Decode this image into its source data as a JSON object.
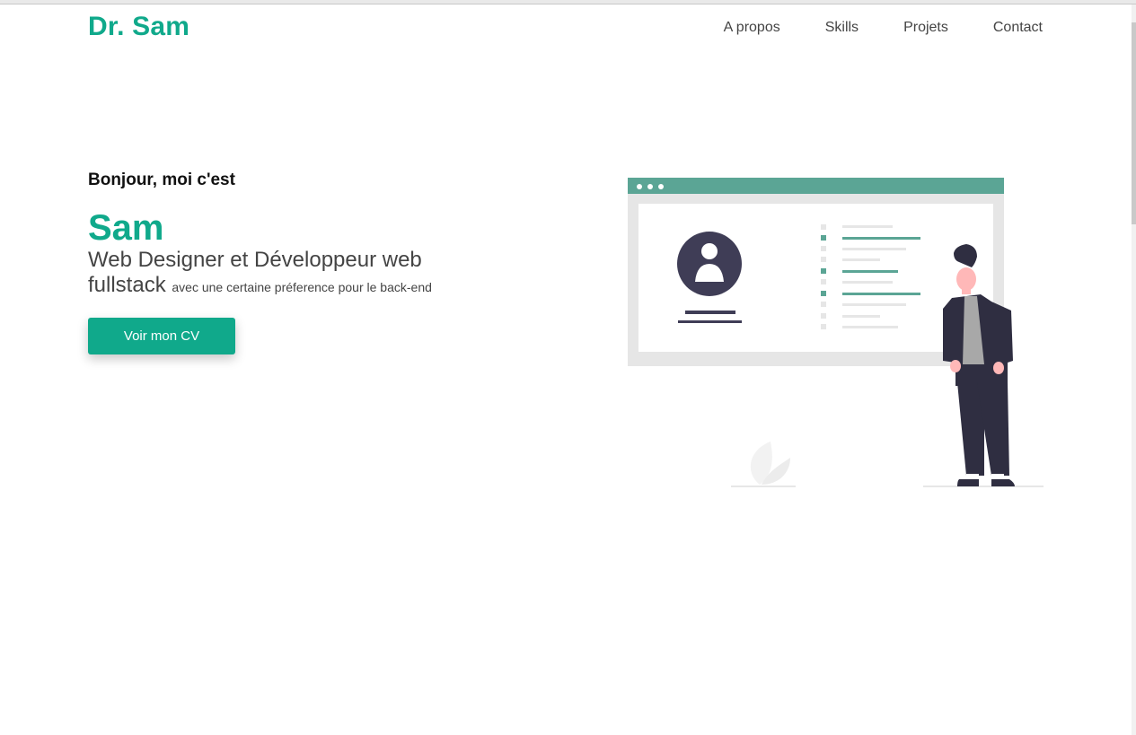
{
  "header": {
    "logo": "Dr. Sam",
    "nav": [
      "A propos",
      "Skills",
      "Projets",
      "Contact"
    ]
  },
  "hero": {
    "greeting": "Bonjour, moi c'est",
    "name": "Sam",
    "role_line1": "Web Designer et Développeur web",
    "role_line2": "fullstack",
    "role_suffix": "avec une certaine préference pour le back-end",
    "cta_label": "Voir mon CV"
  },
  "colors": {
    "accent": "#10a98b",
    "illustration_accent": "#5ba595",
    "dark": "#3f3d56"
  },
  "icons": [
    "profile-avatar-icon"
  ]
}
